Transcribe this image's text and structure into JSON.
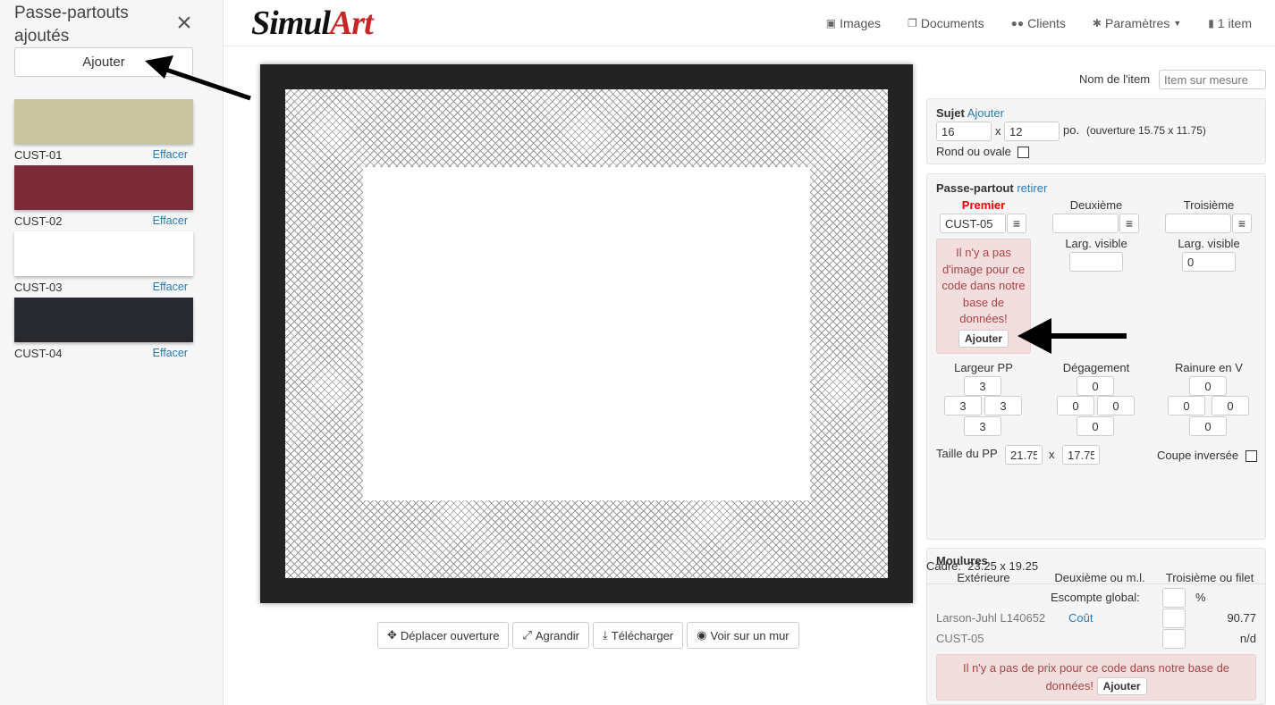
{
  "sidebar": {
    "title": "Passe-partouts ajoutés",
    "add_label": "Ajouter",
    "delete_label": "Effacer",
    "mats": [
      {
        "code": "CUST-01",
        "color": "#c9c3a0"
      },
      {
        "code": "CUST-02",
        "color": "#7b2a38"
      },
      {
        "code": "CUST-03",
        "color": "#ffffff"
      },
      {
        "code": "CUST-04",
        "color": "#27292e"
      }
    ]
  },
  "header": {
    "logo_a": "Simul",
    "logo_b": "Art",
    "nav": [
      {
        "label": "Images",
        "icon": "image-icon"
      },
      {
        "label": "Documents",
        "icon": "documents-icon"
      },
      {
        "label": "Clients",
        "icon": "users-icon"
      },
      {
        "label": "Paramètres",
        "icon": "gear-icon"
      },
      {
        "label": "1 item",
        "icon": "file-icon"
      }
    ]
  },
  "preview": {
    "frame_color": "#232323",
    "actions": [
      {
        "label": "Déplacer ouverture",
        "icon": "move-icon"
      },
      {
        "label": "Agrandir",
        "icon": "expand-icon"
      },
      {
        "label": "Télécharger",
        "icon": "download-icon"
      },
      {
        "label": "Voir sur un mur",
        "icon": "eye-icon"
      }
    ]
  },
  "item": {
    "label": "Nom de l'item",
    "placeholder": "Item sur mesure"
  },
  "subject": {
    "title": "Sujet",
    "add_link": "Ajouter",
    "width": "16",
    "height": "12",
    "by": "x",
    "unit": "po.",
    "opening": "(ouverture 15.75 x 11.75)",
    "round_label": "Rond ou ovale"
  },
  "mat_panel": {
    "title": "Passe-partout",
    "remove_link": "retirer",
    "first_label": "Premier",
    "second_label": "Deuxième",
    "third_label": "Troisième",
    "first_code": "CUST-05",
    "second_code": "",
    "third_code": "",
    "visible_label": "Larg. visible",
    "second_visible": "",
    "third_visible": "0",
    "no_image_alert": "Il n'y a pas d'image pour ce code dans notre base de données!",
    "alert_add": "Ajouter",
    "width_label": "Largeur PP",
    "offset_label": "Dégagement",
    "vgroove_label": "Rainure en V",
    "width_vals": {
      "top": "3",
      "left": "3",
      "right": "3",
      "bottom": "3"
    },
    "offset_vals": {
      "top": "0",
      "left": "0",
      "right": "0",
      "bottom": "0"
    },
    "vgroove_vals": {
      "top": "0",
      "left": "0",
      "right": "0",
      "bottom": "0"
    },
    "size_label": "Taille du PP",
    "size_w": "21.75",
    "size_h": "17.75",
    "by": "x",
    "reverse_label": "Coupe inversée"
  },
  "mouldings": {
    "title": "Moulures",
    "exterior_label": "Extérieure",
    "second_label": "Deuxième ou m.l.",
    "third_label": "Troisième ou filet",
    "exterior_code": "L140652",
    "second_code": "",
    "third_code": ""
  },
  "frame_size": {
    "label": "Cadre:",
    "value": "23.25 x 19.25"
  },
  "pricing": {
    "discount_label": "Escompte global:",
    "percent": "%",
    "line1_name": "Larson-Juhl L140652",
    "cost_link": "Coût",
    "line1_price": "90.77",
    "line2_name": "CUST-05",
    "line2_price": "n/d",
    "no_price_alert": "Il n'y a pas de prix pour ce code dans notre base de données!",
    "alert_add": "Ajouter"
  }
}
